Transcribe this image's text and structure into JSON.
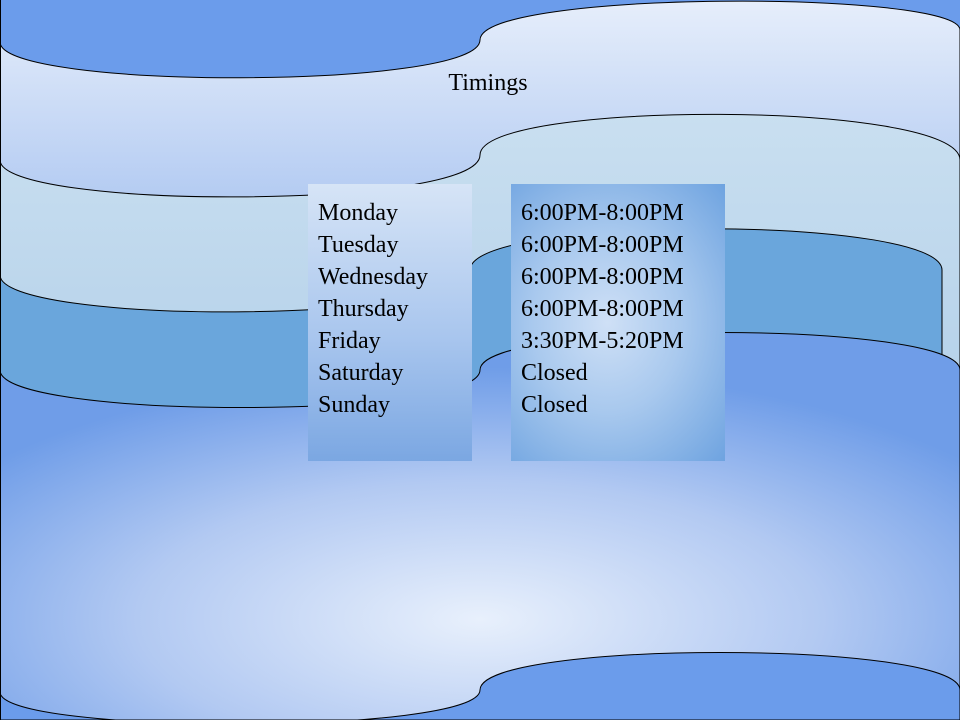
{
  "title": "Timings",
  "schedule": [
    {
      "day": "Monday",
      "time": "6:00PM-8:00PM"
    },
    {
      "day": "Tuesday",
      "time": "6:00PM-8:00PM"
    },
    {
      "day": "Wednesday",
      "time": "6:00PM-8:00PM"
    },
    {
      "day": "Thursday",
      "time": "6:00PM-8:00PM"
    },
    {
      "day": "Friday",
      "time": "3:30PM-5:20PM"
    },
    {
      "day": "Saturday",
      "time": "Closed"
    },
    {
      "day": "Sunday",
      "time": "Closed"
    }
  ],
  "colors": {
    "accent_dark": "#6b9ceb",
    "band_light": "#dbe7f8",
    "band_mid": "#6aa6dc"
  }
}
